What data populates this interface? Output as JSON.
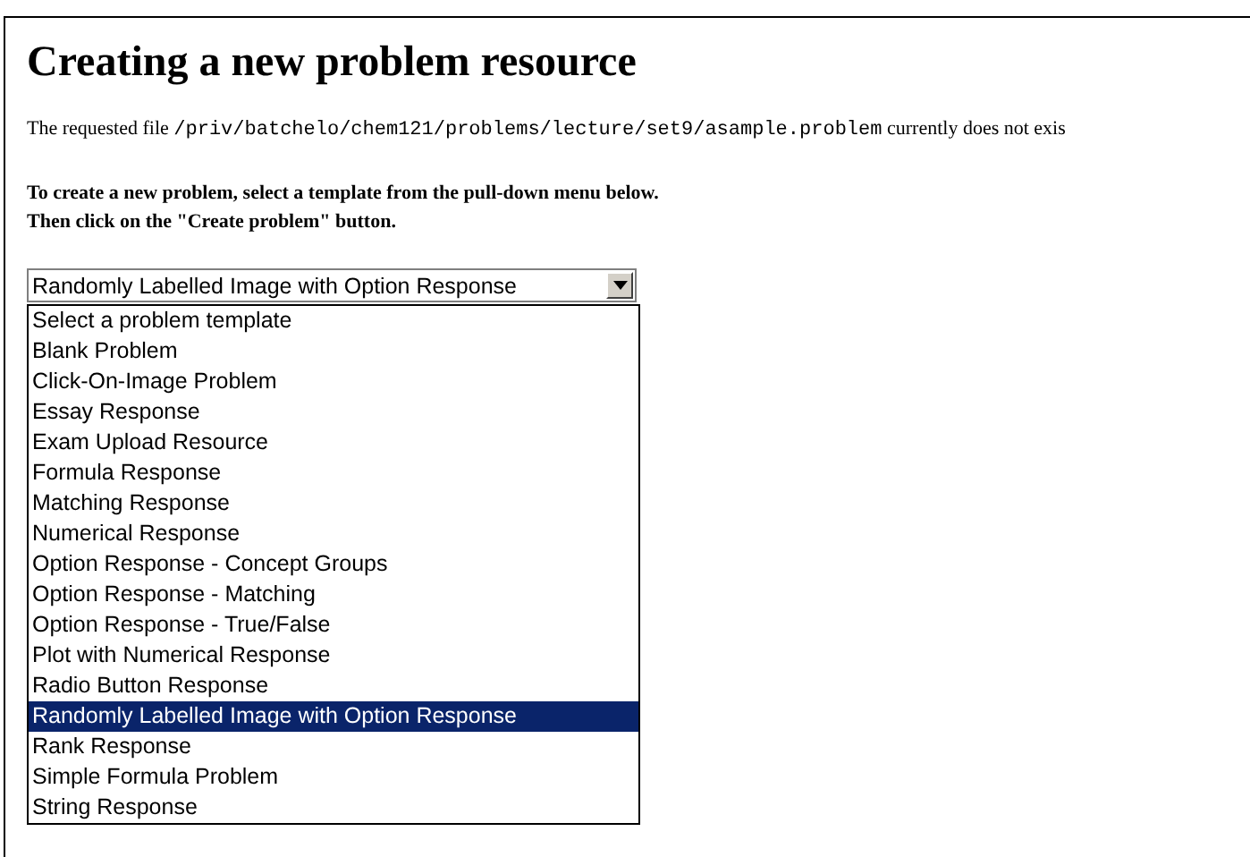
{
  "heading": "Creating a new problem resource",
  "notice": {
    "before": "The requested file",
    "path": "/priv/batchelo/chem121/problems/lecture/set9/asample.problem",
    "after": "currently does not exis"
  },
  "instructions": [
    "To create a new problem, select a template from the pull-down menu below.",
    "Then click on the \"Create problem\" button."
  ],
  "template_select": {
    "value": "Randomly Labelled Image with Option Response"
  },
  "options": [
    {
      "label": "Select a problem template",
      "selected": false
    },
    {
      "label": "Blank Problem",
      "selected": false
    },
    {
      "label": "Click-On-Image Problem",
      "selected": false
    },
    {
      "label": "Essay Response",
      "selected": false
    },
    {
      "label": "Exam Upload Resource",
      "selected": false
    },
    {
      "label": "Formula Response",
      "selected": false
    },
    {
      "label": "Matching Response",
      "selected": false
    },
    {
      "label": "Numerical Response",
      "selected": false
    },
    {
      "label": "Option Response - Concept Groups",
      "selected": false
    },
    {
      "label": "Option Response - Matching",
      "selected": false
    },
    {
      "label": "Option Response - True/False",
      "selected": false
    },
    {
      "label": "Plot with Numerical Response",
      "selected": false
    },
    {
      "label": "Radio Button Response",
      "selected": false
    },
    {
      "label": "Randomly Labelled Image with Option Response",
      "selected": true
    },
    {
      "label": "Rank Response",
      "selected": false
    },
    {
      "label": "Simple Formula Problem",
      "selected": false
    },
    {
      "label": "String Response",
      "selected": false
    }
  ]
}
